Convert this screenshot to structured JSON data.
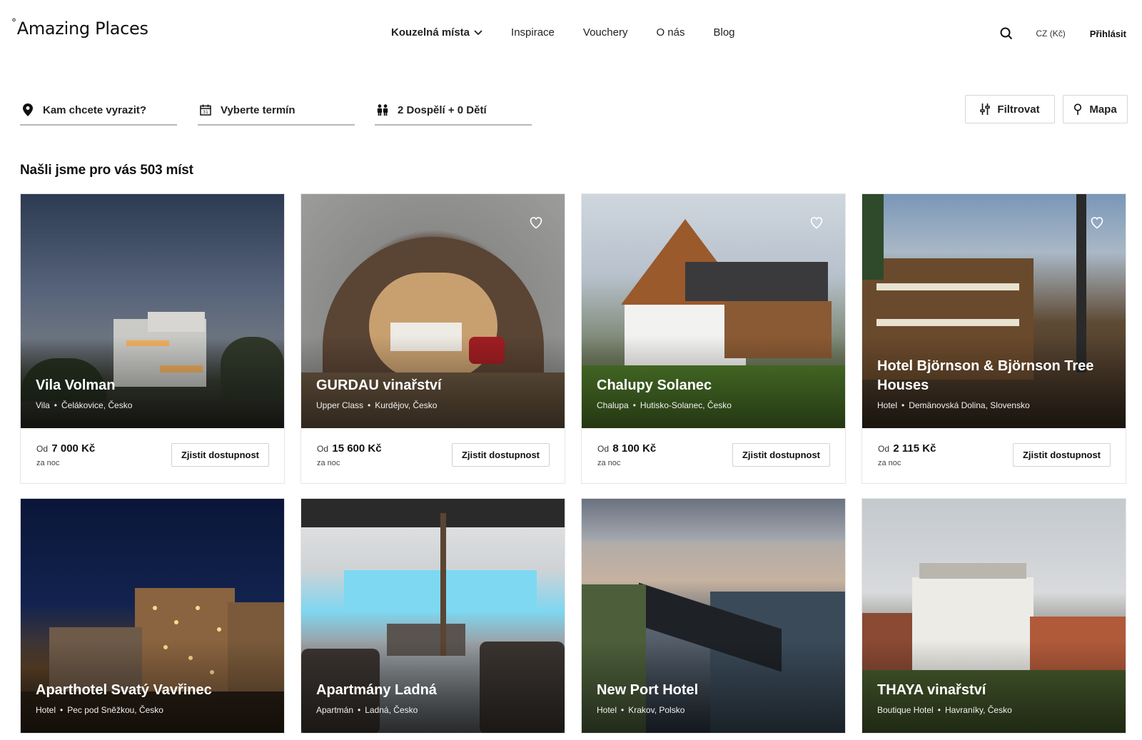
{
  "header": {
    "logo": "Amazing Places",
    "nav": [
      {
        "label": "Kouzelná místa",
        "has_dropdown": true,
        "active": true
      },
      {
        "label": "Inspirace"
      },
      {
        "label": "Vouchery"
      },
      {
        "label": "O nás"
      },
      {
        "label": "Blog"
      }
    ],
    "language": "CZ (Kč)",
    "login": "Přihlásit"
  },
  "search": {
    "destination": "Kam chcete vyrazit?",
    "dates": "Vyberte termín",
    "guests": "2 Dospělí + 0 Dětí",
    "filter_label": "Filtrovat",
    "map_label": "Mapa"
  },
  "results_title": "Našli jsme pro vás 503 míst",
  "card_labels": {
    "price_prefix": "Od",
    "per_night": "za noc",
    "availability": "Zjistit dostupnost"
  },
  "cards": [
    {
      "title": "Vila Volman",
      "type": "Vila",
      "location": "Čelákovice, Česko",
      "price": "7 000 Kč",
      "favorite_icon": false
    },
    {
      "title": "GURDAU vinařství",
      "type": "Upper Class",
      "location": "Kurdějov, Česko",
      "price": "15 600 Kč",
      "favorite_icon": true
    },
    {
      "title": "Chalupy Solanec",
      "type": "Chalupa",
      "location": "Hutisko-Solanec, Česko",
      "price": "8 100 Kč",
      "favorite_icon": true
    },
    {
      "title": "Hotel Björnson & Björnson Tree Houses",
      "type": "Hotel",
      "location": "Demänovská Dolina, Slovensko",
      "price": "2 115 Kč",
      "favorite_icon": true
    },
    {
      "title": "Aparthotel Svatý Vavřinec",
      "type": "Hotel",
      "location": "Pec pod Sněžkou, Česko"
    },
    {
      "title": "Apartmány Ladná",
      "type": "Apartmán",
      "location": "Ladná, Česko"
    },
    {
      "title": "New Port Hotel",
      "type": "Hotel",
      "location": "Krakov, Polsko"
    },
    {
      "title": "THAYA vinařství",
      "type": "Boutique Hotel",
      "location": "Havraníky, Česko"
    }
  ]
}
